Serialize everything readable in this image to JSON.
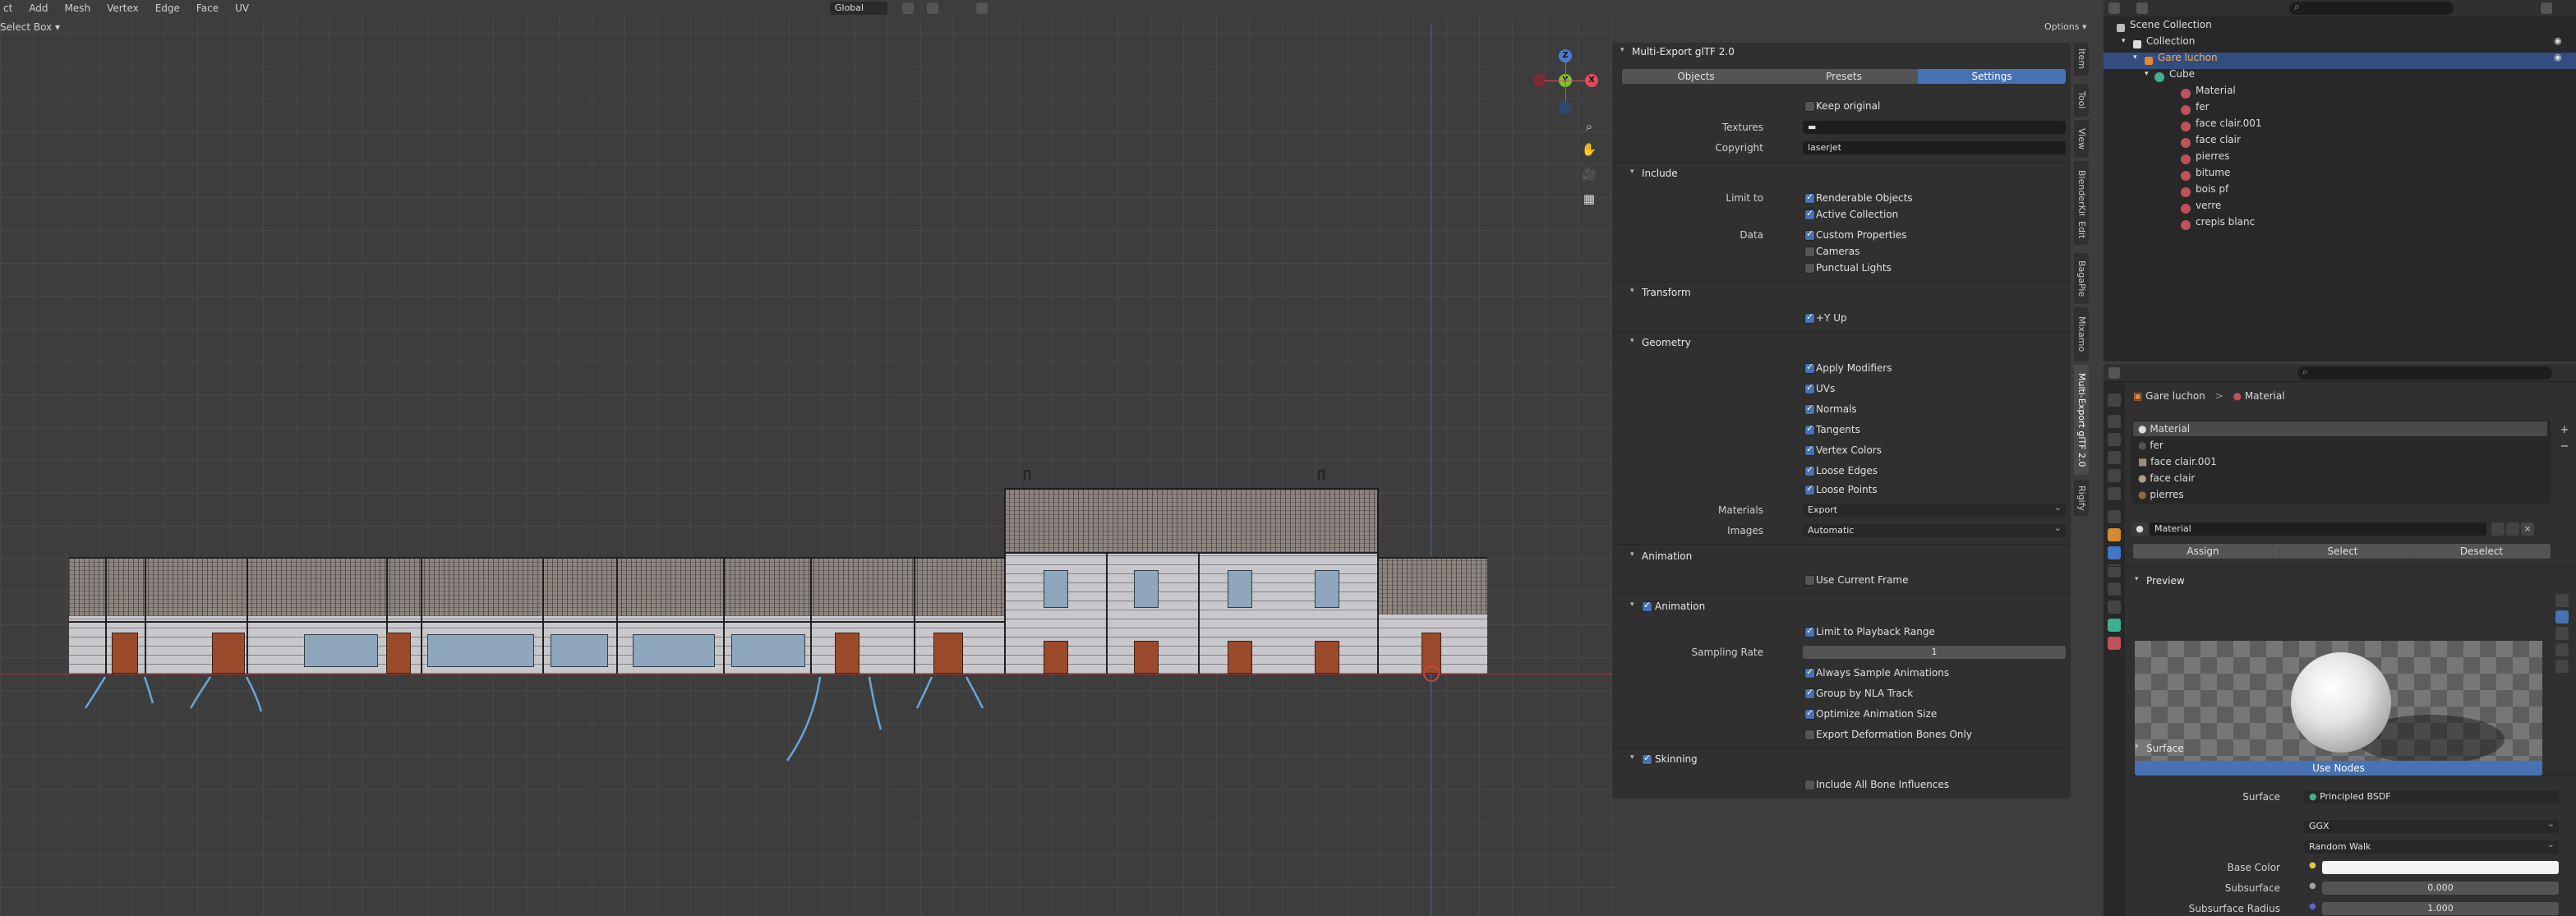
{
  "header": {
    "menus": [
      "ct",
      "Add",
      "Mesh",
      "Vertex",
      "Edge",
      "Face",
      "UV"
    ],
    "select_box": "Select Box",
    "transform_orientation": "Global",
    "options": "Options"
  },
  "gizmo": {
    "z": "Z",
    "y": "Y",
    "x": "X"
  },
  "side_tabs": [
    "Item",
    "Tool",
    "View",
    "BlenderKit",
    "Edit",
    "BagaPie",
    "Mixamo",
    "Multi-Export glTF 2.0",
    "Rigify"
  ],
  "npanel": {
    "title": "Multi-Export glTF 2.0",
    "tabs": [
      "Objects",
      "Presets",
      "Settings"
    ],
    "keep_original": "Keep original",
    "textures_label": "Textures",
    "copyright_label": "Copyright",
    "copyright_value": "laserjet",
    "sections": {
      "include": "Include",
      "transform": "Transform",
      "geometry": "Geometry",
      "animation": "Animation",
      "animation_sub": "Animation",
      "skinning": "Skinning"
    },
    "limit_to_label": "Limit to",
    "renderable_objects": "Renderable Objects",
    "active_collection": "Active Collection",
    "data_label": "Data",
    "custom_properties": "Custom Properties",
    "cameras": "Cameras",
    "punctual_lights": "Punctual Lights",
    "y_up": "+Y Up",
    "apply_modifiers": "Apply Modifiers",
    "uvs": "UVs",
    "normals": "Normals",
    "tangents": "Tangents",
    "vertex_colors": "Vertex Colors",
    "loose_edges": "Loose Edges",
    "loose_points": "Loose Points",
    "materials_label": "Materials",
    "materials_value": "Export",
    "images_label": "Images",
    "images_value": "Automatic",
    "use_current_frame": "Use Current Frame",
    "limit_playback": "Limit to Playback Range",
    "sampling_rate_label": "Sampling Rate",
    "sampling_rate_value": "1",
    "always_sample": "Always Sample Animations",
    "group_nla": "Group by NLA Track",
    "optimize_size": "Optimize Animation Size",
    "export_deform": "Export Deformation Bones Only",
    "include_bone": "Include All Bone Influences"
  },
  "outliner": {
    "scene_collection": "Scene Collection",
    "collection": "Collection",
    "object": "Gare luchon",
    "mesh": "Cube",
    "materials": [
      "Material",
      "fer",
      "face clair.001",
      "face clair",
      "pierres",
      "bitume",
      "bois pf",
      "verre",
      "crepis blanc"
    ]
  },
  "properties": {
    "breadcrumb_object": "Gare luchon",
    "breadcrumb_sep": ">",
    "breadcrumb_material": "Material",
    "slots": [
      "Material",
      "fer",
      "face clair.001",
      "face clair",
      "pierres"
    ],
    "material_name": "Material",
    "assign": "Assign",
    "select": "Select",
    "deselect": "Deselect",
    "preview": "Preview",
    "surface_section": "Surface",
    "use_nodes": "Use Nodes",
    "surface_label": "Surface",
    "surface_value": "Principled BSDF",
    "distribution": "GGX",
    "subsurface_method": "Random Walk",
    "base_color_label": "Base Color",
    "subsurface_label": "Subsurface",
    "subsurface_value": "0.000",
    "subsurface_radius_label": "Subsurface Radius",
    "subsurface_radius_value": "1.000"
  },
  "colors": {
    "accent": "#4772b3",
    "viewport_bg": "#3d3d3d",
    "panel_bg": "#303030",
    "selected_row": "#334d80"
  }
}
